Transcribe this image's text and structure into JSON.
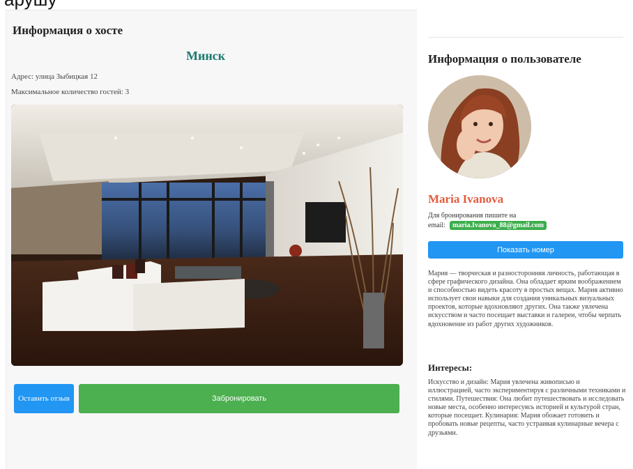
{
  "top_cut_text": "арушу",
  "host": {
    "section_title": "Информация о хосте",
    "city": "Минск",
    "address": "Адрес: улица Зыбицкая 12",
    "max_guests": "Максимальное количество гостей: 3",
    "photo_icon": "living-room-photo"
  },
  "actions": {
    "review_label": "Оставить отзыв",
    "book_label": "Забронировать"
  },
  "user": {
    "section_title": "Информация о пользователе",
    "name": "Maria Ivanova",
    "booking_note": "Для бронирования пишите на",
    "email_prefix": "email:",
    "email": "maria.Ivanova_88@gmail.com",
    "show_phone_label": "Показать номер",
    "bio": "Мария — творческая и разносторонняя личность, работающая в сфере графического дизайна. Она обладает ярким воображением и способностью видеть красоту в простых вещах. Мария активно использует свои навыки для создания уникальных визуальных проектов, которые вдохновляют других. Она также увлечена искусством и часто посещает выставки и галереи, чтобы черпать вдохновение из работ других художников.",
    "interests_title": "Интересы:",
    "interests": "Искусство и дизайн: Мария увлечена живописью и иллюстрацией, часто экспериментируя с различными техниками и стилями. Путешествия: Она любит путешествовать и исследовать новые места, особенно интересуясь историей и культурой стран, которые посещает. Кулинария: Мария обожает готовить и пробовать новые рецепты, часто устраивая кулинарные вечера с друзьями."
  },
  "colors": {
    "accent_blue": "#2196f3",
    "accent_green": "#4caf50",
    "city_teal": "#1b7a6d",
    "name_orange": "#e55a3c"
  }
}
